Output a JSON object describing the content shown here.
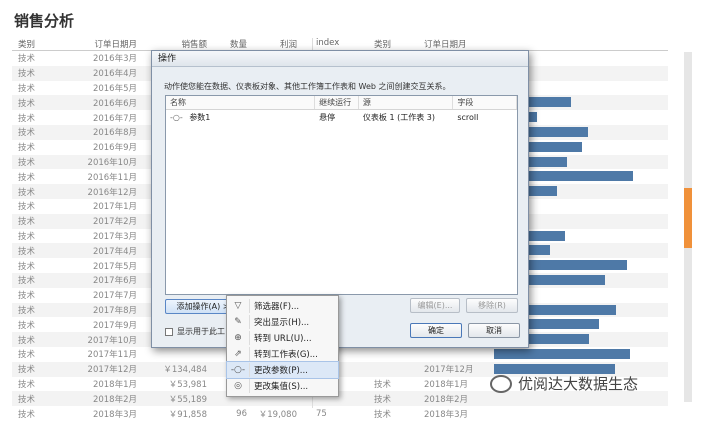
{
  "page": {
    "title": "销售分析"
  },
  "left_table": {
    "headers": [
      "类别",
      "订单日期月",
      "销售额",
      "数量",
      "利润"
    ],
    "rows": [
      [
        "技术",
        "2016年3月",
        "",
        "",
        ""
      ],
      [
        "技术",
        "2016年4月",
        "",
        "",
        ""
      ],
      [
        "技术",
        "2016年5月",
        "",
        "",
        ""
      ],
      [
        "技术",
        "2016年6月",
        "",
        "",
        ""
      ],
      [
        "技术",
        "2016年7月",
        "",
        "",
        ""
      ],
      [
        "技术",
        "2016年8月",
        "",
        "",
        ""
      ],
      [
        "技术",
        "2016年9月",
        "",
        "",
        ""
      ],
      [
        "技术",
        "2016年10月",
        "",
        "",
        ""
      ],
      [
        "技术",
        "2016年11月",
        "",
        "",
        ""
      ],
      [
        "技术",
        "2016年12月",
        "",
        "",
        ""
      ],
      [
        "技术",
        "2017年1月",
        "",
        "",
        ""
      ],
      [
        "技术",
        "2017年2月",
        "",
        "",
        ""
      ],
      [
        "技术",
        "2017年3月",
        "",
        "",
        ""
      ],
      [
        "技术",
        "2017年4月",
        "",
        "",
        ""
      ],
      [
        "技术",
        "2017年5月",
        "",
        "",
        ""
      ],
      [
        "技术",
        "2017年6月",
        "",
        "",
        ""
      ],
      [
        "技术",
        "2017年7月",
        "",
        "",
        ""
      ],
      [
        "技术",
        "2017年8月",
        "",
        "",
        ""
      ],
      [
        "技术",
        "2017年9月",
        "",
        "",
        ""
      ],
      [
        "技术",
        "2017年10月",
        "",
        "",
        ""
      ],
      [
        "技术",
        "2017年11月",
        "",
        "",
        ""
      ],
      [
        "技术",
        "2017年12月",
        "￥134,484",
        "",
        ""
      ],
      [
        "技术",
        "2018年1月",
        "￥53,981",
        "",
        ""
      ],
      [
        "技术",
        "2018年2月",
        "￥55,189",
        "",
        ""
      ],
      [
        "技术",
        "2018年3月",
        "￥91,858",
        "96",
        "￥19,080"
      ]
    ]
  },
  "right_table": {
    "headers": [
      "index",
      "类别",
      "订单日期月"
    ],
    "rows": [
      {
        "idx": "",
        "cat": "",
        "month": "",
        "bar": 0.05
      },
      {
        "idx": "",
        "cat": "",
        "month": "",
        "bar": 0.0
      },
      {
        "idx": "",
        "cat": "",
        "month": "",
        "bar": 0.15
      },
      {
        "idx": "",
        "cat": "",
        "month": "",
        "bar": 0.45
      },
      {
        "idx": "",
        "cat": "",
        "month": "",
        "bar": 0.25
      },
      {
        "idx": "",
        "cat": "",
        "month": "",
        "bar": 0.55
      },
      {
        "idx": "",
        "cat": "",
        "month": "",
        "bar": 0.52
      },
      {
        "idx": "",
        "cat": "",
        "month": "",
        "bar": 0.43
      },
      {
        "idx": "",
        "cat": "",
        "month": "",
        "bar": 0.82
      },
      {
        "idx": "",
        "cat": "",
        "month": "",
        "bar": 0.37
      },
      {
        "idx": "",
        "cat": "",
        "month": "",
        "bar": 0.0
      },
      {
        "idx": "",
        "cat": "",
        "month": "",
        "bar": 0.0
      },
      {
        "idx": "",
        "cat": "",
        "month": "",
        "bar": 0.42
      },
      {
        "idx": "",
        "cat": "",
        "month": "",
        "bar": 0.33
      },
      {
        "idx": "",
        "cat": "",
        "month": "",
        "bar": 0.78
      },
      {
        "idx": "",
        "cat": "",
        "month": "",
        "bar": 0.65
      },
      {
        "idx": "",
        "cat": "",
        "month": "",
        "bar": 0.12
      },
      {
        "idx": "",
        "cat": "",
        "month": "",
        "bar": 0.72
      },
      {
        "idx": "",
        "cat": "",
        "month": "",
        "bar": 0.62
      },
      {
        "idx": "",
        "cat": "",
        "month": "",
        "bar": 0.56
      },
      {
        "idx": "",
        "cat": "",
        "month": "",
        "bar": 0.8
      },
      {
        "idx": "",
        "cat": "",
        "month": "2017年12月",
        "bar": 0.71
      },
      {
        "idx": "",
        "cat": "技术",
        "month": "2018年1月",
        "bar": 0.0
      },
      {
        "idx": "",
        "cat": "技术",
        "month": "2018年2月",
        "bar": 0.0
      },
      {
        "idx": "75",
        "cat": "技术",
        "month": "2018年3月",
        "bar": 0.0
      }
    ]
  },
  "dialog": {
    "title": "操作",
    "description": "动作使您能在数据、仪表板对象、其他工作簿工作表和 Web 之间创建交互关系。",
    "columns": [
      "名称",
      "继续运行",
      "源",
      "字段"
    ],
    "rows": [
      {
        "name": "参数1",
        "run": "悬停",
        "source": "仪表板 1 (工作表 3)",
        "field": "scroll"
      }
    ],
    "add_button": "添加操作(A) >",
    "edit_button": "编辑(E)...",
    "remove_button": "移除(R)",
    "show_checkbox_label": "显示用于此工",
    "ok_button": "确定",
    "cancel_button": "取消"
  },
  "menu": {
    "items": [
      {
        "label": "筛选器(F)...",
        "icon": "filter-icon"
      },
      {
        "label": "突出显示(H)...",
        "icon": "highlight-icon"
      },
      {
        "label": "转到 URL(U)...",
        "icon": "globe-icon"
      },
      {
        "label": "转到工作表(G)...",
        "icon": "goto-sheet-icon"
      },
      {
        "label": "更改参数(P)...",
        "icon": "parameter-icon",
        "highlighted": true
      },
      {
        "label": "更改集值(S)...",
        "icon": "set-icon"
      }
    ]
  },
  "watermark": {
    "text": "优阅达大数据生态"
  },
  "colors": {
    "bar": "#4e79a7",
    "scroll_thumb": "#f0913a",
    "highlight": "#dce8f7"
  }
}
